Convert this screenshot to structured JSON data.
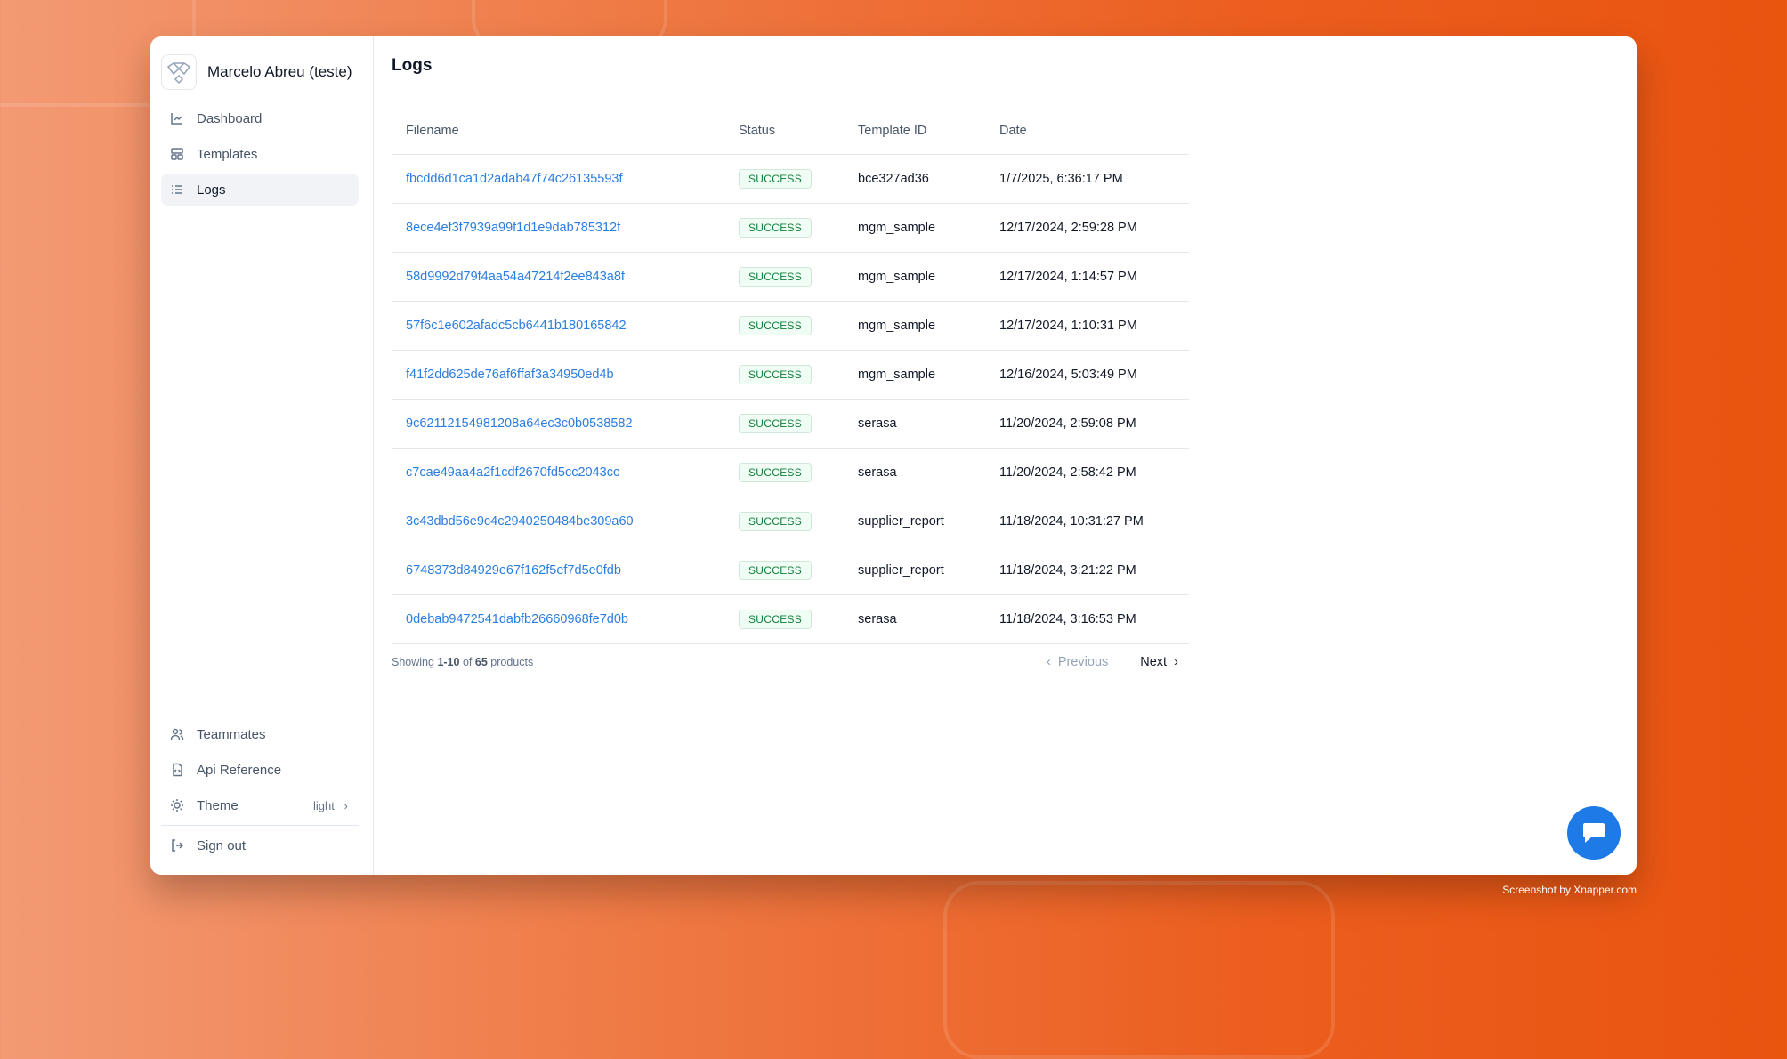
{
  "brand": {
    "name": "Marcelo Abreu (teste)"
  },
  "sidebar": {
    "items": [
      {
        "label": "Dashboard"
      },
      {
        "label": "Templates"
      },
      {
        "label": "Logs"
      }
    ],
    "bottom": {
      "teammates": "Teammates",
      "api": "Api Reference",
      "theme": "Theme",
      "theme_value": "light",
      "signout": "Sign out"
    }
  },
  "page": {
    "title": "Logs"
  },
  "table": {
    "headers": [
      "Filename",
      "Status",
      "Template ID",
      "Date"
    ],
    "rows": [
      [
        "fbcdd6d1ca1d2adab47f74c26135593f",
        "SUCCESS",
        "bce327ad36",
        "1/7/2025, 6:36:17 PM"
      ],
      [
        "8ece4ef3f7939a99f1d1e9dab785312f",
        "SUCCESS",
        "mgm_sample",
        "12/17/2024, 2:59:28 PM"
      ],
      [
        "58d9992d79f4aa54a47214f2ee843a8f",
        "SUCCESS",
        "mgm_sample",
        "12/17/2024, 1:14:57 PM"
      ],
      [
        "57f6c1e602afadc5cb6441b180165842",
        "SUCCESS",
        "mgm_sample",
        "12/17/2024, 1:10:31 PM"
      ],
      [
        "f41f2dd625de76af6ffaf3a34950ed4b",
        "SUCCESS",
        "mgm_sample",
        "12/16/2024, 5:03:49 PM"
      ],
      [
        "9c62112154981208a64ec3c0b0538582",
        "SUCCESS",
        "serasa",
        "11/20/2024, 2:59:08 PM"
      ],
      [
        "c7cae49aa4a2f1cdf2670fd5cc2043cc",
        "SUCCESS",
        "serasa",
        "11/20/2024, 2:58:42 PM"
      ],
      [
        "3c43dbd56e9c4c2940250484be309a60",
        "SUCCESS",
        "supplier_report",
        "11/18/2024, 10:31:27 PM"
      ],
      [
        "6748373d84929e67f162f5ef7d5e0fdb",
        "SUCCESS",
        "supplier_report",
        "11/18/2024, 3:21:22 PM"
      ],
      [
        "0debab9472541dabfb26660968fe7d0b",
        "SUCCESS",
        "serasa",
        "11/18/2024, 3:16:53 PM"
      ]
    ]
  },
  "pagination": {
    "showing": "Showing",
    "range": "1-10",
    "of": "of",
    "total": "65",
    "unit": "products",
    "previous": "Previous",
    "next": "Next"
  },
  "credit": "Screenshot by Xnapper.com"
}
